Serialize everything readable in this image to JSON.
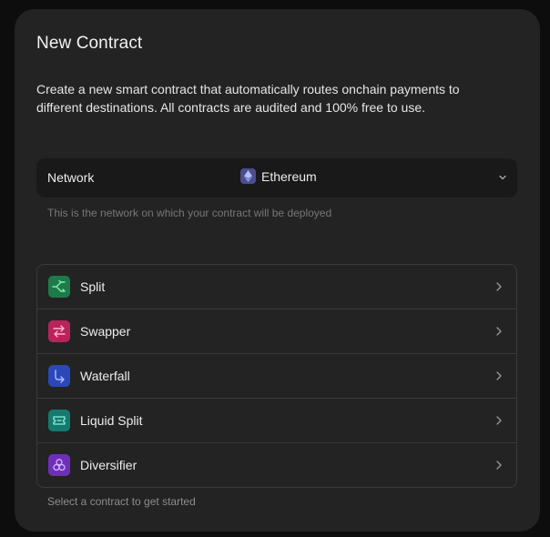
{
  "dialog": {
    "title": "New Contract",
    "description": "Create a new smart contract that automatically routes onchain payments to different destinations. All contracts are audited and 100% free to use."
  },
  "network": {
    "label": "Network",
    "selected": "Ethereum",
    "selected_icon": "ethereum-icon",
    "help": "This is the network on which your contract will be deployed"
  },
  "contracts": {
    "items": [
      {
        "label": "Split",
        "icon": "split-icon",
        "color": "#1f7a4a"
      },
      {
        "label": "Swapper",
        "icon": "swapper-icon",
        "color": "#b8245a"
      },
      {
        "label": "Waterfall",
        "icon": "waterfall-icon",
        "color": "#2b47b8"
      },
      {
        "label": "Liquid Split",
        "icon": "liquid-split-icon",
        "color": "#157a6e"
      },
      {
        "label": "Diversifier",
        "icon": "diversifier-icon",
        "color": "#6e2fb8"
      }
    ],
    "help": "Select a contract to get started"
  }
}
